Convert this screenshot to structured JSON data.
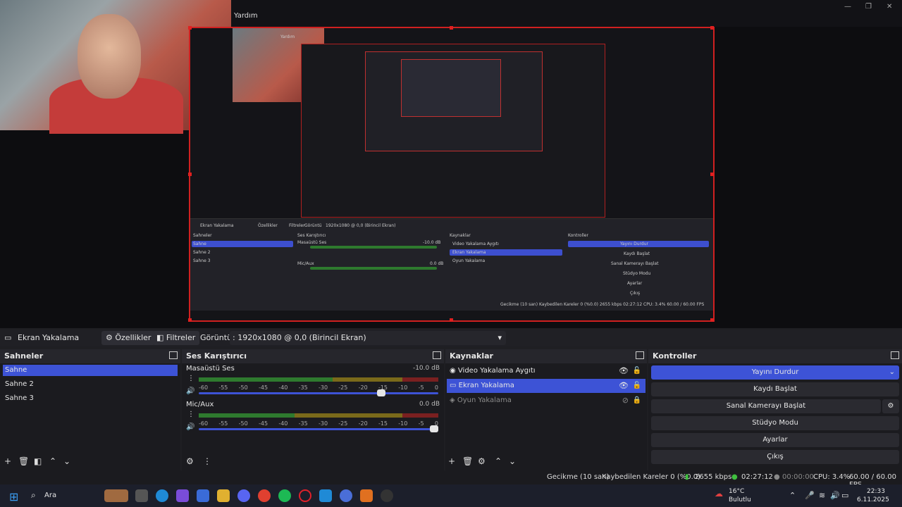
{
  "preview": {
    "menu_label": "Yardım",
    "inner_menu_label": "Yardım"
  },
  "mini": {
    "source_name": "Ekran Yakalama",
    "props": "Özellikler",
    "filters": "Filtreler",
    "display_label": "Görüntü",
    "display_value": "1920x1080 @ 0,0 (Birincil Ekran)",
    "scenes_head": "Sahneler",
    "mixer_head": "Ses Karıştırıcı",
    "sources_head": "Kaynaklar",
    "controls_head": "Kontroller",
    "scenes": [
      "Sahne",
      "Sahne 2",
      "Sahne 3"
    ],
    "mixer_names": [
      "Masaüstü Ses",
      "Mic/Aux"
    ],
    "mixer_db": [
      "-10.0 dB",
      "0.0 dB"
    ],
    "sources": [
      "Video Yakalama Aygıtı",
      "Ekran Yakalama",
      "Oyun Yakalama"
    ],
    "controls": [
      "Yayını Durdur",
      "Kaydı Başlat",
      "Sanal Kamerayı Başlat",
      "Stüdyo Modu",
      "Ayarlar",
      "Çıkış"
    ],
    "status": "Gecikme (10 san)   Kaybedilen Kareler 0 (%0.0)   2655 kbps   02:27:12   CPU: 3.4%   60.00 / 60.00 FPS"
  },
  "source_bar": {
    "source_name": "Ekran Yakalama",
    "properties_label": "Özellikler",
    "filters_label": "Filtreler",
    "display_label": "Görüntü",
    "display_value": ": 1920x1080 @ 0,0 (Birincil Ekran)"
  },
  "scenes": {
    "title": "Sahneler",
    "items": [
      "Sahne",
      "Sahne 2",
      "Sahne 3"
    ],
    "selected_index": 0
  },
  "mixer": {
    "title": "Ses Karıştırıcı",
    "ticks": [
      "-60",
      "-55",
      "-50",
      "-45",
      "-40",
      "-35",
      "-30",
      "-25",
      "-20",
      "-15",
      "-10",
      "-5",
      "0"
    ],
    "channels": [
      {
        "name": "Masaüstü Ses",
        "db": "-10.0 dB",
        "level": 0.56,
        "volume": 0.78
      },
      {
        "name": "Mic/Aux",
        "db": "0.0 dB",
        "level": 0.4,
        "volume": 1.0
      }
    ]
  },
  "sources": {
    "title": "Kaynaklar",
    "items": [
      {
        "name": "Video Yakalama Aygıtı",
        "visible": true,
        "locked": false
      },
      {
        "name": "Ekran Yakalama",
        "visible": true,
        "locked": false
      },
      {
        "name": "Oyun Yakalama",
        "visible": false,
        "locked": true
      }
    ],
    "selected_index": 1
  },
  "controls": {
    "title": "Kontroller",
    "stop_stream": "Yayını Durdur",
    "start_record": "Kaydı Başlat",
    "virtual_cam": "Sanal Kamerayı Başlat",
    "studio_mode": "Stüdyo Modu",
    "settings": "Ayarlar",
    "exit": "Çıkış"
  },
  "status": {
    "delay": "Gecikme (10 san)",
    "dropped": "Kaybedilen Kareler 0 (%0.0)",
    "bitrate": "2655 kbps",
    "stream_time": "02:27:12",
    "record_time": "00:00:00",
    "cpu": "CPU: 3.4%",
    "fps": "60.00 / 60.00 FPS"
  },
  "taskbar": {
    "search_label": "Ara",
    "weather_temp": "16°C",
    "weather_desc": "Bulutlu",
    "time": "22:33",
    "date": "6.11.2025"
  },
  "colors": {
    "accent": "#3d53d6",
    "capture_border": "#d02020"
  }
}
